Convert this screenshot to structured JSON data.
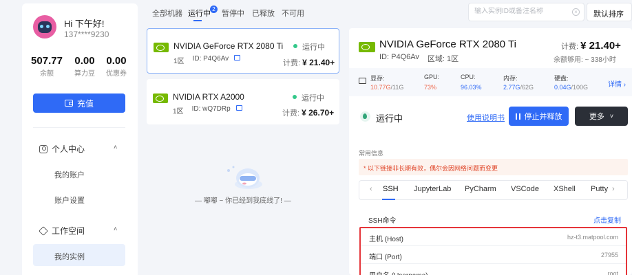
{
  "user": {
    "greeting": "Hi 下午好!",
    "phone": "137****9230",
    "stats": [
      {
        "value": "507.77",
        "label": "余额"
      },
      {
        "value": "0.00",
        "label": "算力豆"
      },
      {
        "value": "0.00",
        "label": "优惠券"
      }
    ],
    "recharge_label": "充值"
  },
  "nav": {
    "personal": {
      "label": "个人中心",
      "items": [
        "我的账户",
        "账户设置"
      ]
    },
    "workspace": {
      "label": "工作空间",
      "items": [
        "我的实例"
      ]
    }
  },
  "tabs": {
    "items": [
      "全部机器",
      "运行中",
      "暂停中",
      "已释放",
      "不可用"
    ],
    "active_badge": "2"
  },
  "search": {
    "placeholder": "输入实例ID或备注名称",
    "clear": "×"
  },
  "sort": {
    "label": "默认排序"
  },
  "instances": [
    {
      "name": "NVIDIA GeForce RTX 2080 Ti",
      "zone": "1区",
      "id": "ID: P4Q6Av",
      "status": "运行中",
      "price_label": "计费:",
      "price": "¥ 21.40+"
    },
    {
      "name": "NVIDIA RTX A2000",
      "zone": "1区",
      "id": "ID: wQ7DRp",
      "status": "运行中",
      "price_label": "计费:",
      "price": "¥ 26.70+"
    }
  ],
  "empty": {
    "text": "— 嘟嘟 ~ 你已经到我底线了! —"
  },
  "detail": {
    "title": "NVIDIA GeForce RTX 2080 Ti",
    "id": "ID: P4Q6Av",
    "zone": "区域: 1区",
    "price_label": "计费:",
    "price": "¥ 21.40+",
    "remaining": "余额够用: ~ 338小时",
    "resources": [
      {
        "label": "显存:",
        "used": "10.77G",
        "total": "/11G"
      },
      {
        "label": "GPU:",
        "used": "73%",
        "total": ""
      },
      {
        "label": "CPU:",
        "used": "96.03%",
        "total": ""
      },
      {
        "label": "内存:",
        "used": "2.77G",
        "total": "/62G"
      },
      {
        "label": "硬盘:",
        "used": "0.04G",
        "total": "/100G"
      }
    ],
    "details_link": "详情",
    "status": "运行中",
    "manual_link": "使用说明书",
    "stop_button": "停止并释放",
    "more_button": "更多",
    "common_info": "常用信息",
    "notice": "* 以下链接非长期有效，偶尔会因网络问题而变更",
    "conn_tabs": [
      "SSH",
      "JupyterLab",
      "PyCharm",
      "VSCode",
      "XShell",
      "Putty"
    ],
    "ssh_command_label": "SSH命令",
    "copy_link": "点击复制",
    "ssh_rows": [
      {
        "key": "主机 (Host)",
        "value": "hz-t3.matpool.com"
      },
      {
        "key": "端口 (Port)",
        "value": "27955"
      },
      {
        "key": "用户名 (Username)",
        "value": "root"
      }
    ]
  },
  "colors": {
    "accent": "#2f6af6",
    "running": "#33c88a",
    "highlight": "#ee6a4f",
    "alert": "#e5353a"
  }
}
